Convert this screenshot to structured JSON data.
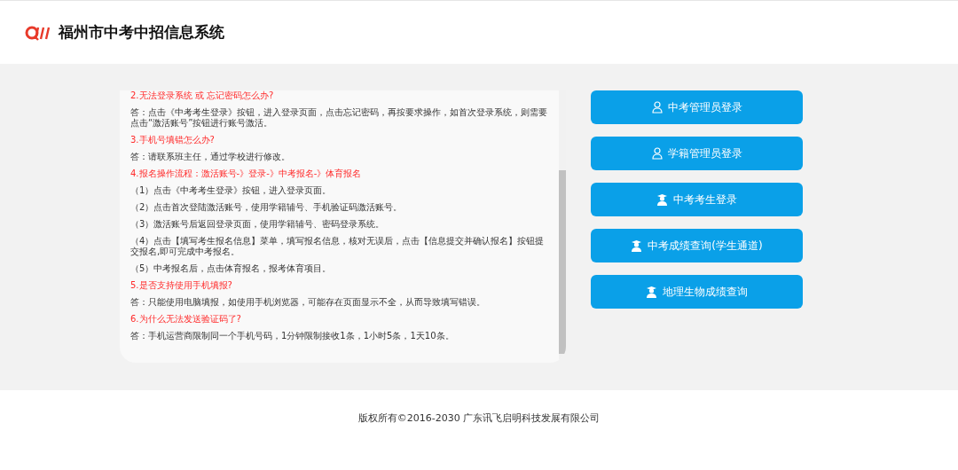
{
  "header": {
    "title": "福州市中考中招信息系统"
  },
  "faq": [
    {
      "kind": "question",
      "text": "2.无法登录系统 或 忘记密码怎么办?"
    },
    {
      "kind": "answer",
      "text": "答：点击《中考考生登录》按钮，进入登录页面，点击忘记密码，再按要求操作，如首次登录系统，则需要点击“激活账号”按钮进行账号激活。"
    },
    {
      "kind": "question",
      "text": "3.手机号填错怎么办?"
    },
    {
      "kind": "answer",
      "text": "答：请联系班主任，通过学校进行修改。"
    },
    {
      "kind": "question",
      "text": "4.报名操作流程：激活账号-》登录-》中考报名-》体育报名"
    },
    {
      "kind": "answer",
      "text": "（1）点击《中考考生登录》按钮，进入登录页面。"
    },
    {
      "kind": "answer",
      "text": "（2）点击首次登陆激活账号，使用学籍辅号、手机验证码激活账号。"
    },
    {
      "kind": "answer",
      "text": "（3）激活账号后返回登录页面，使用学籍辅号、密码登录系统。"
    },
    {
      "kind": "answer",
      "text": "（4）点击【填写考生报名信息】菜单，填写报名信息，核对无误后，点击【信息提交并确认报名】按钮提交报名,即可完成中考报名。"
    },
    {
      "kind": "answer",
      "text": "（5）中考报名后，点击体育报名，报考体育项目。"
    },
    {
      "kind": "question",
      "text": "5.是否支持使用手机填报?"
    },
    {
      "kind": "answer",
      "text": "答：只能使用电脑填报，如使用手机浏览器，可能存在页面显示不全，从而导致填写错误。"
    },
    {
      "kind": "question",
      "text": "6.为什么无法发送验证码了?"
    },
    {
      "kind": "answer",
      "text": "答：手机运营商限制同一个手机号码，1分钟限制接收1条，1小时5条，1天10条。"
    }
  ],
  "buttons": [
    {
      "kind": "staff",
      "label": "中考管理员登录"
    },
    {
      "kind": "staff",
      "label": "学籍管理员登录"
    },
    {
      "kind": "student",
      "label": "中考考生登录"
    },
    {
      "kind": "student",
      "label": "中考成绩查询(学生通道)"
    },
    {
      "kind": "student",
      "label": "地理生物成绩查询"
    }
  ],
  "footer": {
    "text": "版权所有©2016-2030 广东讯飞启明科技发展有限公司"
  }
}
